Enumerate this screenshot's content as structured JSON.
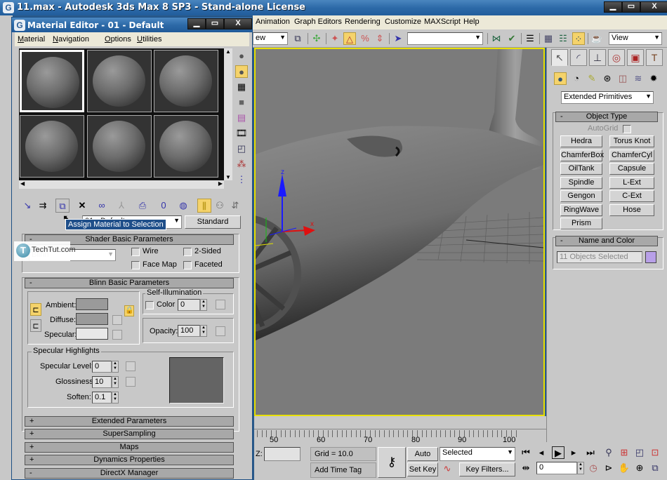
{
  "main_window": {
    "title": "11.max - Autodesk 3ds Max 8 SP3  - Stand-alone License",
    "app_logo_glyph": "G",
    "window_buttons": {
      "minimize": "▁",
      "maximize": "▭",
      "close": "X"
    }
  },
  "main_menu": [
    "Animation",
    "Graph Editors",
    "Rendering",
    "Customize",
    "MAXScript",
    "Help"
  ],
  "main_toolbar": {
    "coord_combo_partial": "ew",
    "selection_set_combo": "",
    "view_combo": "View"
  },
  "material_editor": {
    "title": "Material Editor - 01 - Default",
    "menu": [
      "Material",
      "Navigation",
      "Options",
      "Utilities"
    ],
    "slots": 6,
    "active_slot": 0,
    "tooltip": "Assign Material to Selection",
    "material_name_combo": "01 - Default",
    "material_type_button": "Standard",
    "shader_rollout": {
      "title": "Shader Basic Parameters",
      "shader": "Blinn",
      "checkboxes": [
        {
          "label": "Wire",
          "checked": false
        },
        {
          "label": "2-Sided",
          "checked": false
        },
        {
          "label": "Face Map",
          "checked": false
        },
        {
          "label": "Faceted",
          "checked": false
        }
      ]
    },
    "blinn_rollout": {
      "title": "Blinn Basic Parameters",
      "ambient_label": "Ambient:",
      "diffuse_label": "Diffuse:",
      "specular_label": "Specular:",
      "ambient_color": "#9a9a9a",
      "diffuse_color": "#9a9a9a",
      "specular_color": "#e8e8e8",
      "self_illum_group": "Self-Illumination",
      "color_label": "Color",
      "self_illum_value": "0",
      "opacity_label": "Opacity:",
      "opacity_value": "100",
      "spec_group": "Specular Highlights",
      "spec_level_label": "Specular Level:",
      "spec_level_value": "0",
      "glossiness_label": "Glossiness:",
      "glossiness_value": "10",
      "soften_label": "Soften:",
      "soften_value": "0.1"
    },
    "collapsed_rollouts": [
      {
        "sign": "+",
        "title": "Extended Parameters"
      },
      {
        "sign": "+",
        "title": "SuperSampling"
      },
      {
        "sign": "+",
        "title": "Maps"
      },
      {
        "sign": "+",
        "title": "Dynamics Properties"
      },
      {
        "sign": "-",
        "title": "DirectX Manager"
      }
    ]
  },
  "watermark": {
    "text": "TechTut.com",
    "glyph": "T"
  },
  "command_panel": {
    "tabs": [
      "create",
      "modify",
      "hierarchy",
      "motion",
      "display",
      "utilities"
    ],
    "category_dropdown": "Extended Primitives",
    "object_type": {
      "title": "Object Type",
      "autogrid_label": "AutoGrid",
      "buttons": [
        "Hedra",
        "Torus Knot",
        "ChamferBox",
        "ChamferCyl",
        "OilTank",
        "Capsule",
        "Spindle",
        "L-Ext",
        "Gengon",
        "C-Ext",
        "RingWave",
        "Hose",
        "Prism"
      ]
    },
    "name_color": {
      "title": "Name and Color",
      "name_value": "11 Objects Selected",
      "color": "#b8a0e8"
    }
  },
  "viewport": {
    "axis_labels": {
      "z": "z",
      "x": "x"
    }
  },
  "timeline": {
    "ticks": [
      "50",
      "60",
      "70",
      "80",
      "90",
      "100"
    ]
  },
  "status": {
    "z_label": "Z:",
    "z_value": "",
    "grid": "Grid = 10.0",
    "add_time_tag": "Add Time Tag",
    "auto_key": "Auto Key",
    "set_key": "Set Key",
    "key_mode_combo": "Selected",
    "key_filters": "Key Filters...",
    "frame_value": "0"
  },
  "colors": {
    "viewport_border": "#e8e000",
    "active_button": "#f5d36b",
    "titlebar": "#2d6aa8"
  }
}
